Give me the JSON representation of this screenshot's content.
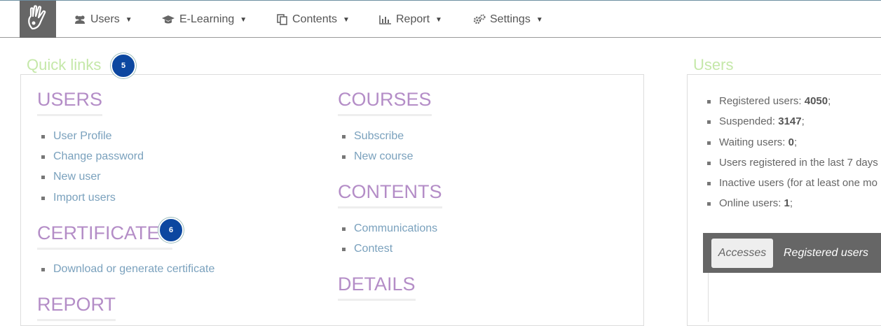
{
  "nav": {
    "items": [
      {
        "label": "Users",
        "icon": "users-icon"
      },
      {
        "label": "E-Learning",
        "icon": "graduation-cap-icon"
      },
      {
        "label": "Contents",
        "icon": "files-icon"
      },
      {
        "label": "Report",
        "icon": "bar-chart-icon"
      },
      {
        "label": "Settings",
        "icon": "gears-icon"
      }
    ]
  },
  "quick_links": {
    "title": "Quick links",
    "badge": "5",
    "certificates_badge": "6",
    "users": {
      "heading": "USERS",
      "links": [
        "User Profile",
        "Change password",
        "New user",
        "Import users"
      ]
    },
    "certificates": {
      "heading": "CERTIFICATES",
      "links": [
        "Download or generate certificate"
      ]
    },
    "report": {
      "heading": "REPORT"
    },
    "courses": {
      "heading": "COURSES",
      "links": [
        "Subscribe",
        "New course"
      ]
    },
    "contents": {
      "heading": "CONTENTS",
      "links": [
        "Communications",
        "Contest"
      ]
    },
    "details": {
      "heading": "DETAILS"
    }
  },
  "users_panel": {
    "title": "Users",
    "stats": [
      {
        "label": "Registered users: ",
        "value": "4050",
        "suffix": ";"
      },
      {
        "label": "Suspended: ",
        "value": "3147",
        "suffix": ";"
      },
      {
        "label": "Waiting users: ",
        "value": "0",
        "suffix": ";"
      },
      {
        "label": "Users registered in the last 7 days",
        "value": "",
        "suffix": ""
      },
      {
        "label": "Inactive users (for at least one mo",
        "value": "",
        "suffix": ""
      },
      {
        "label": "Online users: ",
        "value": "1",
        "suffix": ";"
      }
    ],
    "tabs": [
      "Accesses",
      "Registered users"
    ]
  },
  "colors": {
    "section_title": "#c5e8a9",
    "category_heading": "#b48dc7",
    "link": "#7aa1bd",
    "badge": "#0c47a0",
    "logo_bg": "#666666"
  }
}
